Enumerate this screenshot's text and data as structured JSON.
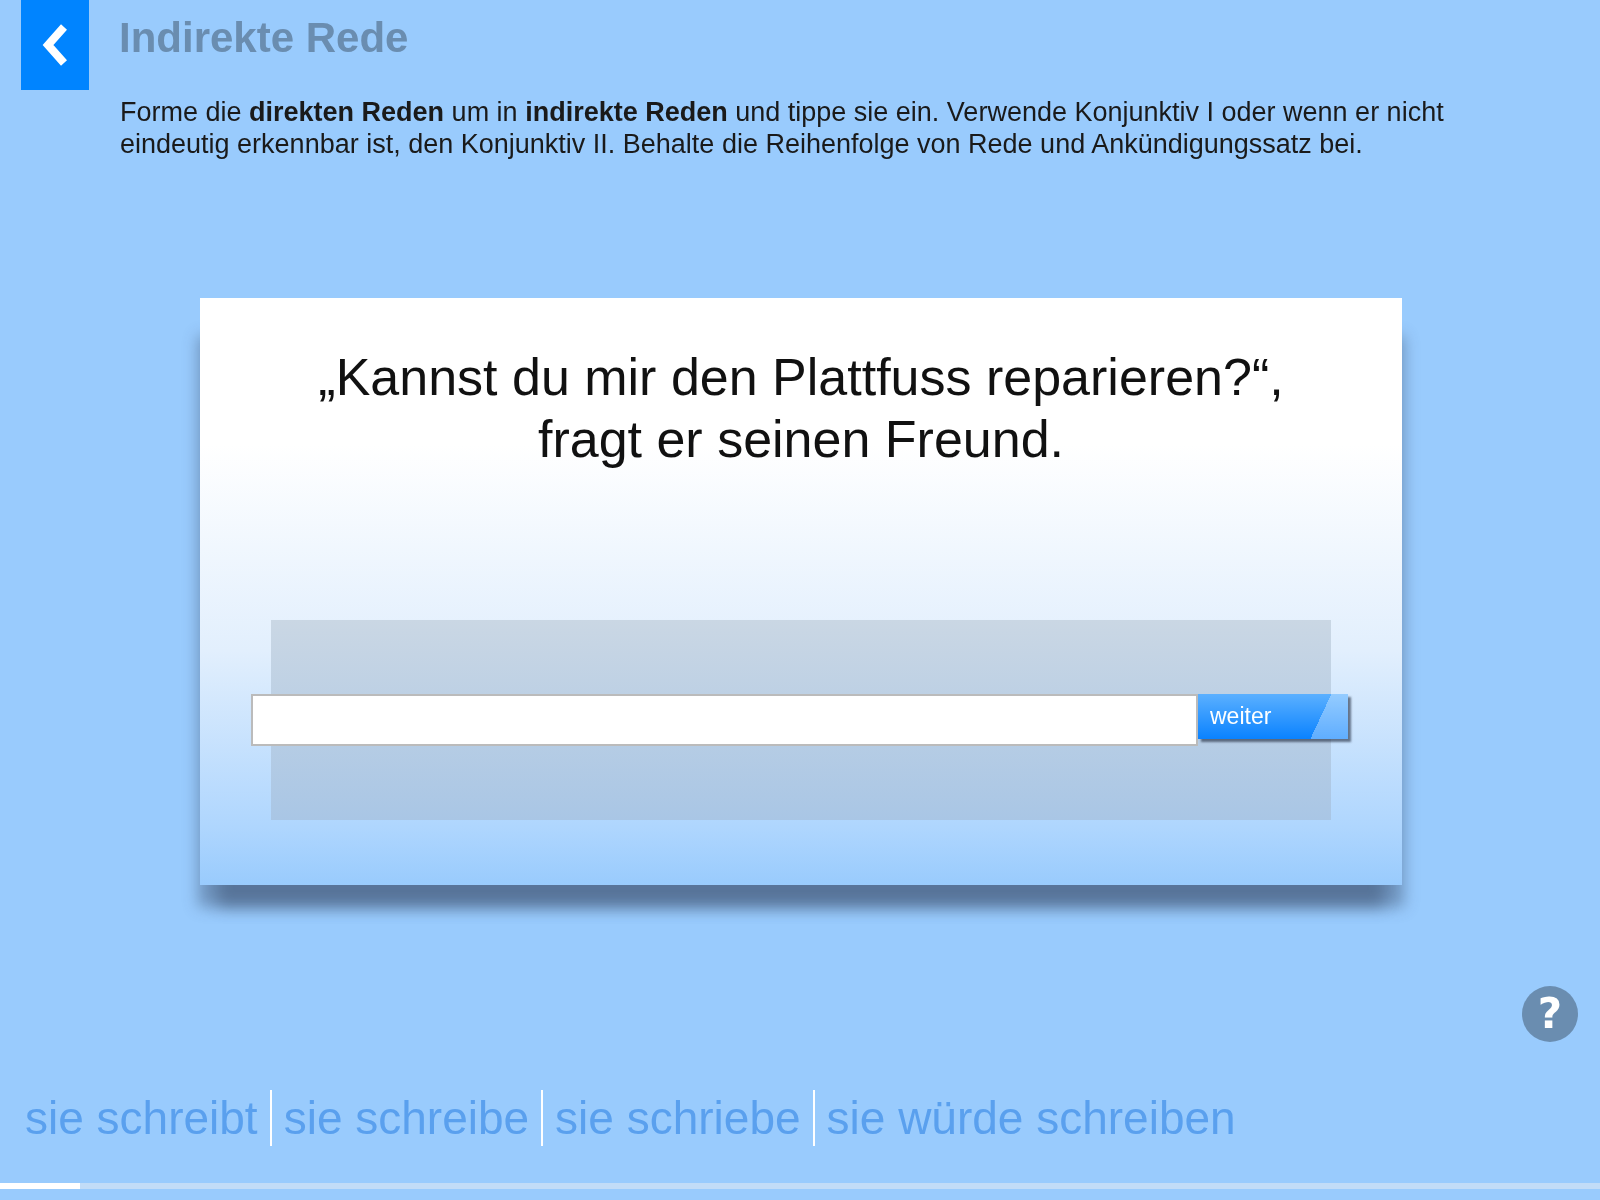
{
  "header": {
    "title": "Indirekte Rede"
  },
  "instruction": "Forme die **direkten Reden** um in **indirekte Reden** und tippe sie ein. Verwende Konjunktiv I oder wenn er nicht eindeutig erkennbar ist, den Konjunktiv II. Behalte die Reihenfolge von Rede und Ankündigungssatz bei.",
  "card": {
    "quote_lines": [
      "„Kannst du mir den Plattfuss reparieren?“,",
      "fragt er seinen Freund."
    ],
    "button": "weiter"
  },
  "help": "?",
  "word_options": [
    "sie schreibt",
    "sie schreibe",
    "sie schriebe",
    "sie würde schreiben"
  ],
  "progress": {
    "level": 0.05
  }
}
